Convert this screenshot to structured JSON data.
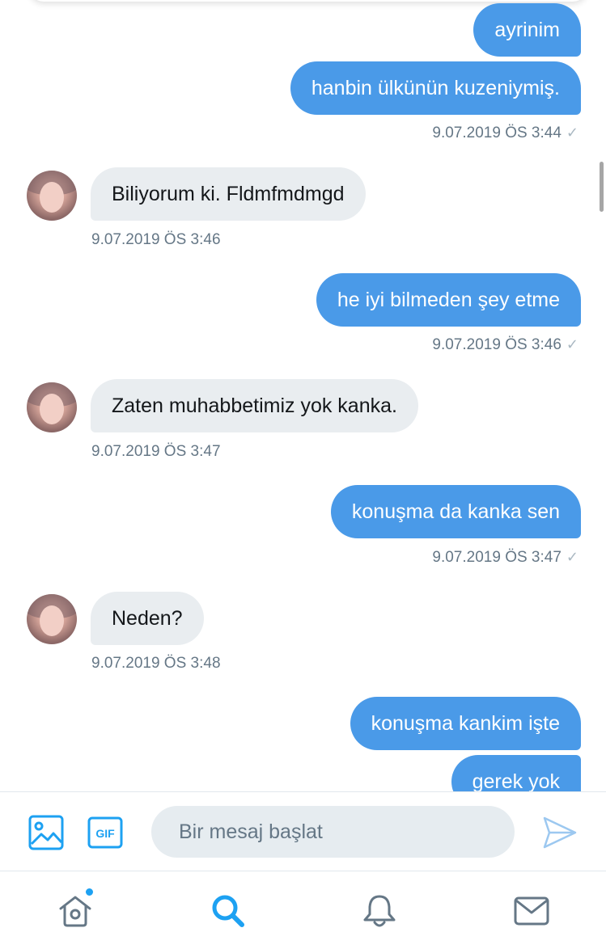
{
  "messages": [
    {
      "dir": "out",
      "text": "ayrinim"
    },
    {
      "dir": "out",
      "text": "hanbin ülkünün kuzeniymiş."
    },
    {
      "dir": "out",
      "timestamp": "9.07.2019 ÖS 3:44",
      "check": "✓"
    },
    {
      "dir": "in",
      "text": "Biliyorum ki. Fldmfmdmgd",
      "timestamp": "9.07.2019 ÖS 3:46"
    },
    {
      "dir": "out",
      "text": "he iyi bilmeden şey etme",
      "timestamp": "9.07.2019 ÖS 3:46",
      "check": "✓"
    },
    {
      "dir": "in",
      "text": "Zaten muhabbetimiz yok kanka.",
      "timestamp": "9.07.2019 ÖS 3:47"
    },
    {
      "dir": "out",
      "text": "konuşma da kanka sen",
      "timestamp": "9.07.2019 ÖS 3:47",
      "check": "✓"
    },
    {
      "dir": "in",
      "text": "Neden?",
      "timestamp": "9.07.2019 ÖS 3:48"
    },
    {
      "dir": "out",
      "text": "konuşma kankim işte"
    },
    {
      "dir": "out",
      "text": "gerek yok"
    }
  ],
  "composer": {
    "placeholder": "Bir mesaj başlat",
    "gif_label": "GIF",
    "image_icon": "image-icon",
    "send_icon": "send-icon"
  },
  "tabbar": {
    "items": [
      "home-icon",
      "search-icon",
      "bell-icon",
      "mail-icon"
    ],
    "active": "search-icon",
    "has_notification_dot": true
  },
  "colors": {
    "outgoing_bubble": "#4a9ae8",
    "incoming_bubble": "#e9edf0",
    "accent": "#1da1f2",
    "timestamp": "#657786"
  }
}
